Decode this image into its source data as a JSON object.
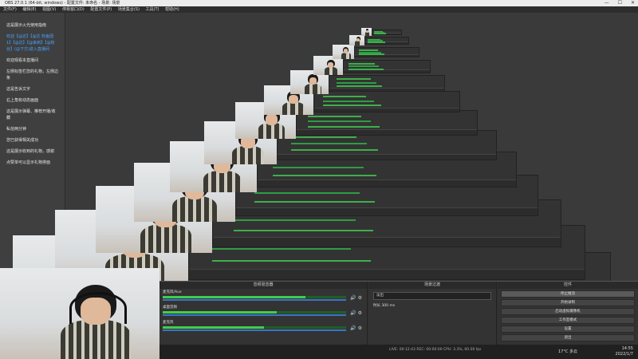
{
  "window": {
    "title": "OBS 27.0.1 (64-bit, windows) - 配置文件: 未命名 - 场景: 场景",
    "controls": [
      "—",
      "☐",
      "✕"
    ]
  },
  "menu": [
    "文件(F)",
    "编辑(E)",
    "视图(V)",
    "停靠窗口(D)",
    "配置文件(P)",
    "场景集合(S)",
    "工具(T)",
    "帮助(H)"
  ],
  "chat": {
    "lines": [
      {
        "text": "这是展示火光使用指南",
        "cls": ""
      },
      {
        "text": "欢迎【@达】【@达 粉鱼团 1】【@达】【@来到】【@粉丝】(@下方)进入直播间",
        "cls": "hl"
      },
      {
        "text": "欢迎观看本直播间",
        "cls": ""
      },
      {
        "text": "左侧标签栏您的礼物，左侧边条",
        "cls": ""
      },
      {
        "text": "这是告诉文字",
        "cls": ""
      },
      {
        "text": "右上角有动态画面",
        "cls": ""
      },
      {
        "text": "这是展示弹幕、推荐开播/收藏",
        "cls": ""
      },
      {
        "text": "私信两分钟",
        "cls": ""
      },
      {
        "text": "您已获得相关成功",
        "cls": ""
      },
      {
        "text": "这是展示收到的礼物，感谢",
        "cls": ""
      },
      {
        "text": "点赞单可以显示礼物排面",
        "cls": ""
      }
    ]
  },
  "mixer": {
    "title": "音频混音器",
    "channels": [
      {
        "name": "麦克风/Aux",
        "level": 0.78,
        "db": "0.0 dB"
      },
      {
        "name": "桌面音频",
        "level": 0.62,
        "db": "0.0 dB"
      },
      {
        "name": "麦克风",
        "level": 0.55,
        "db": "0.0 dB"
      }
    ],
    "icons": [
      "speaker-icon",
      "gear-icon"
    ]
  },
  "transitions": {
    "title": "场景过渡",
    "selected": "淡出",
    "duration_label": "时长",
    "duration_value": "300 ms"
  },
  "controls": {
    "title": "控件",
    "buttons": [
      {
        "label": "停止推流",
        "active": true
      },
      {
        "label": "开始录制",
        "active": false
      },
      {
        "label": "启动虚拟摄像机",
        "active": false
      },
      {
        "label": "工作室模式",
        "active": false
      },
      {
        "label": "设置",
        "active": false
      },
      {
        "label": "退出",
        "active": false
      }
    ]
  },
  "status": {
    "text": "LIVE: 00:12:43  REC: 00:00:00  CPU: 3.3%, 60.00 fps"
  },
  "taskbar": {
    "weather": "17°C 多云",
    "time": "14:55",
    "date": "2022/1/7"
  },
  "colors": {
    "meter_green": "#3fcf4a",
    "meter_blue": "#3a74c7",
    "bg": "#3a3a3a"
  }
}
